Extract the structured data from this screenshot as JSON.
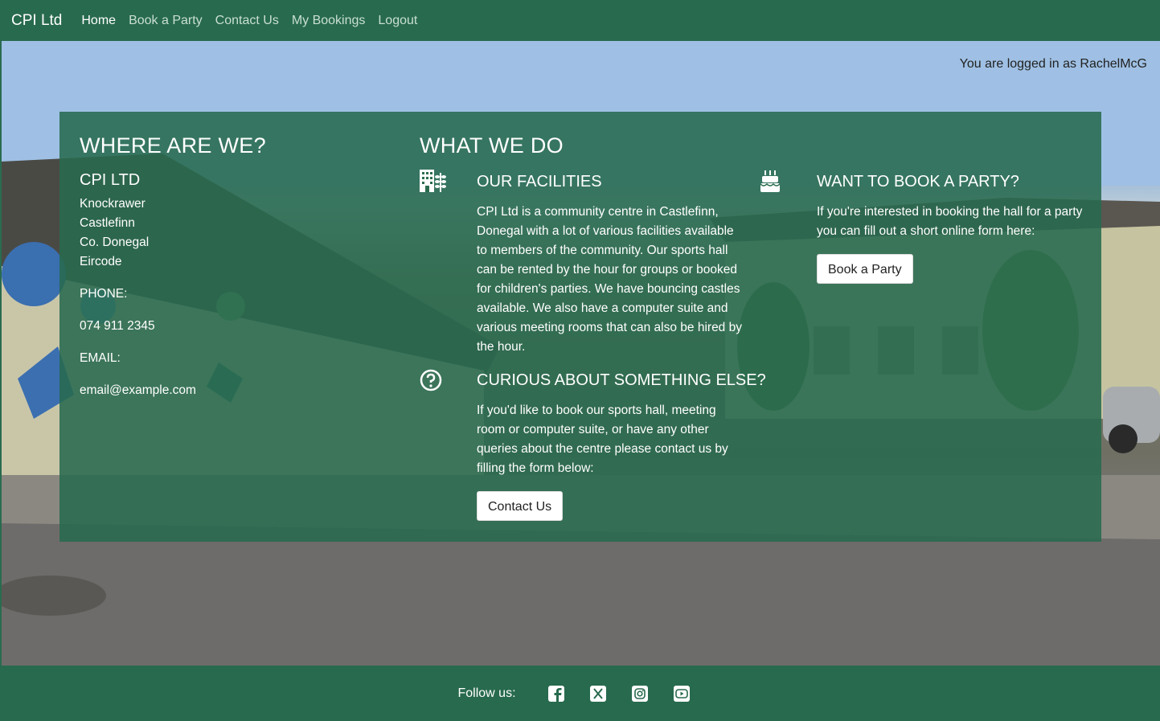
{
  "nav": {
    "brand": "CPI Ltd",
    "links": [
      "Home",
      "Book a Party",
      "Contact Us",
      "My Bookings",
      "Logout"
    ]
  },
  "user": {
    "logged_in_text": "You are logged in as RachelMcG"
  },
  "where": {
    "heading": "WHERE ARE WE?",
    "company": "CPI LTD",
    "address": [
      "Knockrawer",
      "Castlefinn",
      "Co. Donegal",
      "Eircode"
    ],
    "phone_label": "PHONE:",
    "phone": "074 911 2345",
    "email_label": "EMAIL:",
    "email": "email@example.com"
  },
  "what": {
    "heading": "WHAT WE DO",
    "facilities": {
      "title": "OUR FACILITIES",
      "text": "CPI Ltd is a community centre in Castlefinn, Donegal with a lot of various facilities available to members of the community. Our sports hall can be rented by the hour for groups or booked for children's parties. We have bouncing castles available. We also have a computer suite and various meeting rooms that can also be hired by the hour."
    },
    "curious": {
      "title": "CURIOUS ABOUT SOMETHING ELSE?",
      "text": "If you'd like to book our sports hall, meeting room or computer suite, or have any other queries about the centre please contact us by filling the form below:",
      "button": "Contact Us"
    },
    "party": {
      "title": "WANT TO BOOK A PARTY?",
      "text": "If you're interested in booking the hall for a party you can fill out a short online form here:",
      "button": "Book a Party"
    }
  },
  "footer": {
    "follow": "Follow us:",
    "socials": [
      "facebook-icon",
      "x-twitter-icon",
      "instagram-icon",
      "youtube-icon"
    ]
  },
  "colors": {
    "brand_green": "#286a4e",
    "panel_green": "rgba(40,106,78,0.88)"
  }
}
